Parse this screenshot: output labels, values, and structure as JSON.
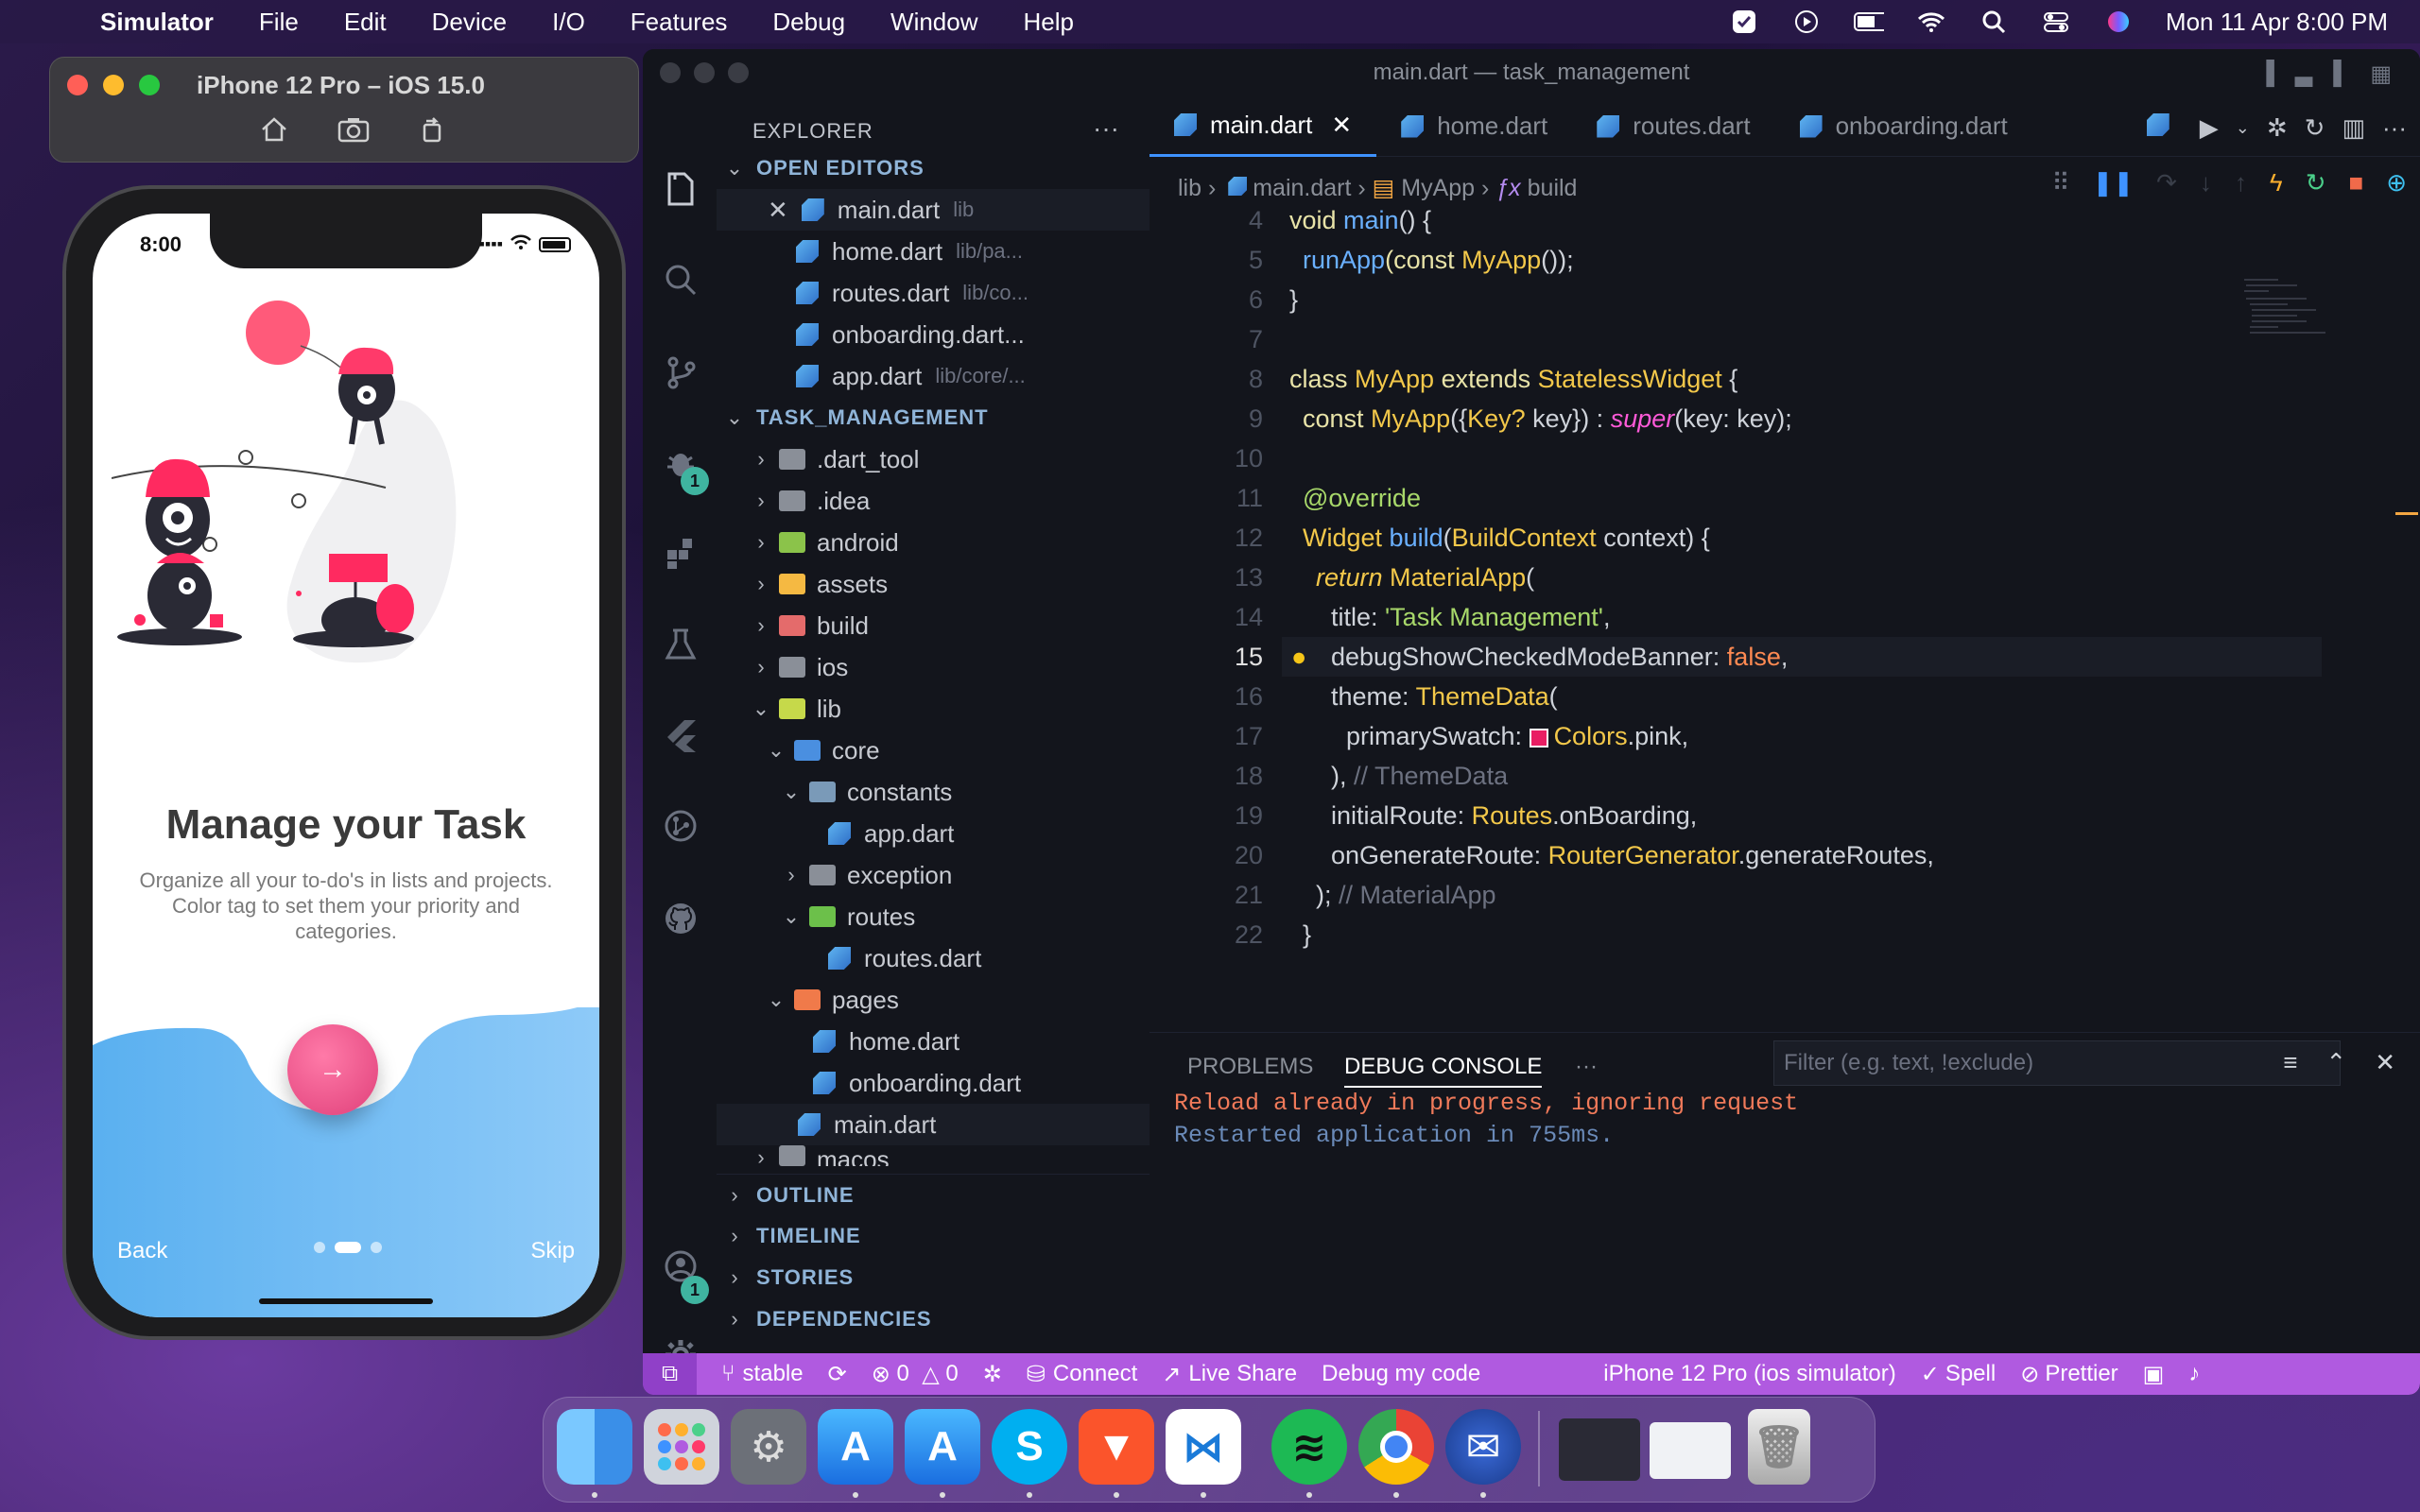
{
  "menubar": {
    "app": "Simulator",
    "items": [
      "File",
      "Edit",
      "Device",
      "I/O",
      "Features",
      "Debug",
      "Window",
      "Help"
    ],
    "datetime": "Mon 11 Apr  8:00 PM"
  },
  "simulator": {
    "title": "iPhone 12 Pro – iOS 15.0",
    "time": "8:00",
    "heading": "Manage your Task",
    "description": "Organize all your to-do's in lists and projects. Color tag to set them your priority and categories.",
    "back": "Back",
    "skip": "Skip",
    "fab_icon": "→"
  },
  "vscode": {
    "title": "main.dart — task_management",
    "tabs": [
      {
        "label": "main.dart",
        "active": true
      },
      {
        "label": "home.dart"
      },
      {
        "label": "routes.dart"
      },
      {
        "label": "onboarding.dart"
      }
    ],
    "breadcrumb": {
      "p1": "lib",
      "p2": "main.dart",
      "p3": "MyApp",
      "p4": "build"
    },
    "explorer": {
      "title": "EXPLORER",
      "open_editors": "OPEN EDITORS",
      "open": [
        {
          "name": "main.dart",
          "path": "lib"
        },
        {
          "name": "home.dart",
          "path": "lib/pa..."
        },
        {
          "name": "routes.dart",
          "path": "lib/co..."
        },
        {
          "name": "onboarding.dart...",
          "path": ""
        },
        {
          "name": "app.dart",
          "path": "lib/core/..."
        }
      ],
      "project": "TASK_MANAGEMENT",
      "tree": [
        ".dart_tool",
        ".idea",
        "android",
        "assets",
        "build",
        "ios",
        "lib",
        "core",
        "constants",
        "app.dart",
        "exception",
        "routes",
        "routes.dart",
        "pages",
        "home.dart",
        "onboarding.dart",
        "main.dart",
        "macos"
      ],
      "sections": [
        "OUTLINE",
        "TIMELINE",
        "STORIES",
        "DEPENDENCIES"
      ]
    },
    "activity_badges": {
      "debug": "1",
      "accounts": "1"
    },
    "code": {
      "l4": {
        "n": "4",
        "a": "void",
        "b": " main",
        "c": "() {"
      },
      "l5": {
        "n": "5",
        "a": "runApp",
        "b": "(const ",
        "c": "MyApp",
        "d": "());"
      },
      "l6": {
        "n": "6",
        "a": "}"
      },
      "l7": {
        "n": "7"
      },
      "l8": {
        "n": "8",
        "a": "class ",
        "b": "MyApp",
        "c": " extends ",
        "d": "StatelessWidget",
        "e": " {"
      },
      "l9": {
        "n": "9",
        "a": "const ",
        "b": "MyApp",
        "c": "({",
        "d": "Key?",
        "e": " key}) : ",
        "f": "super",
        "g": "(key: key);"
      },
      "l10": {
        "n": "10"
      },
      "l11": {
        "n": "11",
        "a": "@override"
      },
      "l12": {
        "n": "12",
        "a": "Widget ",
        "b": "build",
        "c": "(",
        "d": "BuildContext",
        "e": " context) {"
      },
      "l13": {
        "n": "13",
        "a": "return ",
        "b": "MaterialApp",
        "c": "("
      },
      "l14": {
        "n": "14",
        "a": "title: ",
        "b": "'Task Management'",
        "c": ","
      },
      "l15": {
        "n": "15",
        "a": "debugShowCheckedModeBanner: ",
        "b": "false",
        "c": ","
      },
      "l16": {
        "n": "16",
        "a": "theme: ",
        "b": "ThemeData",
        "c": "("
      },
      "l17": {
        "n": "17",
        "a": "primarySwatch: ",
        "b": "Colors",
        "c": ".pink,"
      },
      "l18": {
        "n": "18",
        "a": "), ",
        "b": "// ThemeData"
      },
      "l19": {
        "n": "19",
        "a": "initialRoute: ",
        "b": "Routes",
        "c": ".onBoarding,"
      },
      "l20": {
        "n": "20",
        "a": "onGenerateRoute: ",
        "b": "RouterGenerator",
        "c": ".generateRoutes,"
      },
      "l21": {
        "n": "21",
        "a": "); ",
        "b": "// MaterialApp"
      },
      "l22": {
        "n": "22",
        "a": "}"
      }
    },
    "panel": {
      "problems": "PROBLEMS",
      "debug_console": "DEBUG CONSOLE",
      "more": "···",
      "filter_placeholder": "Filter (e.g. text, !exclude)",
      "line1": "Reload already in progress, ignoring request",
      "line2": "Restarted application in 755ms."
    },
    "status": {
      "branch": "stable",
      "errors": "0",
      "warnings": "0",
      "connect": "Connect",
      "liveshare": "Live Share",
      "debug": "Debug my code",
      "device": "iPhone 12 Pro (ios simulator)",
      "spell": "Spell",
      "prettier": "Prettier"
    }
  },
  "colors": {
    "status": "#b05ae0",
    "accent": "#3e92ff",
    "pink": "#e91e63"
  }
}
